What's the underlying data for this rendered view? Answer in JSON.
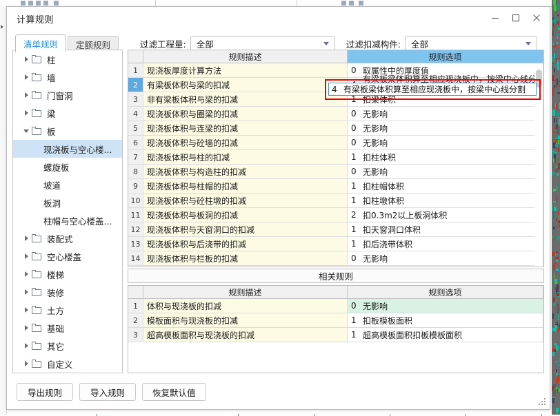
{
  "background": {
    "app_hint": "underlying application window"
  },
  "window": {
    "title": "计算规则",
    "controls": [
      {
        "name": "minimize",
        "glyph": "—"
      },
      {
        "name": "maximize",
        "glyph": "□"
      },
      {
        "name": "close",
        "glyph": "✕"
      }
    ]
  },
  "tabs": [
    {
      "label": "清单规则",
      "active": true
    },
    {
      "label": "定额规则",
      "active": false
    }
  ],
  "filters": [
    {
      "label": "过滤工程量:",
      "value": "全部"
    },
    {
      "label": "过滤扣减构件:",
      "value": "全部"
    }
  ],
  "tree": {
    "items": [
      {
        "label": "柱",
        "level": 0,
        "expanded": false,
        "folder": true,
        "selected": false
      },
      {
        "label": "墙",
        "level": 0,
        "expanded": false,
        "folder": true,
        "selected": false
      },
      {
        "label": "门窗洞",
        "level": 0,
        "expanded": false,
        "folder": true,
        "selected": false
      },
      {
        "label": "梁",
        "level": 0,
        "expanded": false,
        "folder": true,
        "selected": false
      },
      {
        "label": "板",
        "level": 0,
        "expanded": true,
        "folder": true,
        "selected": false
      },
      {
        "label": "现浇板与空心楼...",
        "level": 1,
        "expanded": false,
        "folder": false,
        "selected": true
      },
      {
        "label": "螺旋板",
        "level": 1,
        "expanded": false,
        "folder": false,
        "selected": false
      },
      {
        "label": "坡道",
        "level": 1,
        "expanded": false,
        "folder": false,
        "selected": false
      },
      {
        "label": "板洞",
        "level": 1,
        "expanded": false,
        "folder": false,
        "selected": false
      },
      {
        "label": "柱帽与空心楼盖...",
        "level": 1,
        "expanded": false,
        "folder": false,
        "selected": false
      },
      {
        "label": "装配式",
        "level": 0,
        "expanded": false,
        "folder": true,
        "selected": false
      },
      {
        "label": "空心楼盖",
        "level": 0,
        "expanded": false,
        "folder": true,
        "selected": false
      },
      {
        "label": "楼梯",
        "level": 0,
        "expanded": false,
        "folder": true,
        "selected": false
      },
      {
        "label": "装修",
        "level": 0,
        "expanded": false,
        "folder": true,
        "selected": false
      },
      {
        "label": "土方",
        "level": 0,
        "expanded": false,
        "folder": true,
        "selected": false
      },
      {
        "label": "基础",
        "level": 0,
        "expanded": false,
        "folder": true,
        "selected": false
      },
      {
        "label": "其它",
        "level": 0,
        "expanded": false,
        "folder": true,
        "selected": false
      },
      {
        "label": "自定义",
        "level": 0,
        "expanded": false,
        "folder": true,
        "selected": false
      }
    ]
  },
  "main_grid": {
    "headers": {
      "index": "",
      "desc": "规则描述",
      "option": "规则选项"
    },
    "rows": [
      {
        "n": "1",
        "desc": "现浇板厚度计算方法",
        "num": "0",
        "opt": "取属性中的厚度值",
        "selected": false
      },
      {
        "n": "2",
        "desc": "有梁板体积与梁的扣减",
        "num": "4",
        "opt": "有梁板梁体积算至相应现浇板中，按梁中心线分割",
        "selected": true
      },
      {
        "n": "3",
        "desc": "非有梁板体积与梁的扣减",
        "num": "1",
        "opt": "扣梁体积",
        "selected": false
      },
      {
        "n": "4",
        "desc": "现浇板体积与圈梁的扣减",
        "num": "0",
        "opt": "无影响",
        "selected": false
      },
      {
        "n": "5",
        "desc": "现浇板体积与连梁的扣减",
        "num": "0",
        "opt": "无影响",
        "selected": false
      },
      {
        "n": "6",
        "desc": "现浇板体积与砼墙的扣减",
        "num": "0",
        "opt": "无影响",
        "selected": false
      },
      {
        "n": "7",
        "desc": "现浇板体积与柱的扣减",
        "num": "1",
        "opt": "扣柱体积",
        "selected": false
      },
      {
        "n": "8",
        "desc": "现浇板体积与构造柱的扣减",
        "num": "0",
        "opt": "无影响",
        "selected": false
      },
      {
        "n": "9",
        "desc": "现浇板体积与柱帽的扣减",
        "num": "1",
        "opt": "扣柱帽体积",
        "selected": false
      },
      {
        "n": "10",
        "desc": "现浇板体积与砼柱墩的扣减",
        "num": "1",
        "opt": "扣柱墩体积",
        "selected": false
      },
      {
        "n": "11",
        "desc": "现浇板体积与板洞的扣减",
        "num": "2",
        "opt": "扣0.3m2以上板洞体积",
        "selected": false
      },
      {
        "n": "12",
        "desc": "现浇板体积与天窗洞口的扣减",
        "num": "1",
        "opt": "扣天窗洞口体积",
        "selected": false
      },
      {
        "n": "13",
        "desc": "现浇板体积与后浇带的扣减",
        "num": "1",
        "opt": "扣后浇带体积",
        "selected": false
      },
      {
        "n": "14",
        "desc": "现浇板体积与栏板的扣减",
        "num": "0",
        "opt": "无影响",
        "selected": false
      }
    ]
  },
  "edit_cell": {
    "num": "4",
    "text": "有梁板梁体积算至相应现浇板中，按梁中心线分割"
  },
  "related_band": {
    "title": "相关规则"
  },
  "related_grid": {
    "headers": {
      "index": "",
      "desc": "规则描述",
      "option": "规则选项"
    },
    "rows": [
      {
        "n": "1",
        "desc": "体积与现浇板的扣减",
        "num": "0",
        "opt": "无影响",
        "highlight": true
      },
      {
        "n": "2",
        "desc": "模板面积与现浇板的扣减",
        "num": "1",
        "opt": "扣板模板面积",
        "highlight": false
      },
      {
        "n": "3",
        "desc": "超高模板面积与现浇板的扣减",
        "num": "1",
        "opt": "超高模板面积扣板模板面积",
        "highlight": false
      }
    ]
  },
  "buttons": [
    {
      "label": "导出规则"
    },
    {
      "label": "导入规则"
    },
    {
      "label": "恢复默认值"
    }
  ],
  "colors": {
    "accent_blue": "#7fc3ef",
    "selected_row": "#5fa9e0",
    "desc_cell": "#fdfbe4",
    "mint_cell": "#d9f2e4",
    "annotation_red": "#ef0000",
    "tree_selection": "#cfe3f7",
    "tab_active_text": "#2090d8"
  }
}
